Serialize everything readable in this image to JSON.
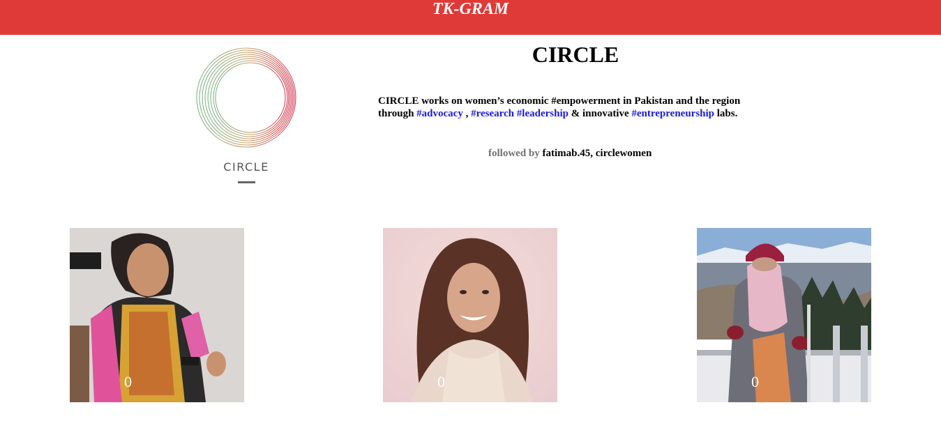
{
  "header": {
    "brand": "TK-GRAM",
    "background_color": "#df3a38"
  },
  "profile": {
    "logo_icon": "circle-rings-logo",
    "logo_text": "CIRCLE",
    "name": "CIRCLE",
    "bio": {
      "line1_text": "CIRCLE works on women’s economic #empowerment in Pakistan and the region",
      "line2_prefix": "through ",
      "tag_advocacy": "#advocacy",
      "sep1": " , ",
      "tag_research": "#research",
      "sep2": " ",
      "tag_leadership": "#leadership",
      "mid_text": " & innovative ",
      "tag_entrepreneurship": "#entrepreneurship",
      "suffix": " labs."
    },
    "followed_label": "followed by",
    "followed_users": "fatimab.45, circlewomen",
    "link_color": "#1a1ae0"
  },
  "posts": [
    {
      "likes": "0",
      "image": "woman-speaking-photo"
    },
    {
      "likes": "0",
      "image": "smiling-woman-selfie-photo"
    },
    {
      "likes": "0",
      "image": "woman-mountains-photo"
    }
  ]
}
